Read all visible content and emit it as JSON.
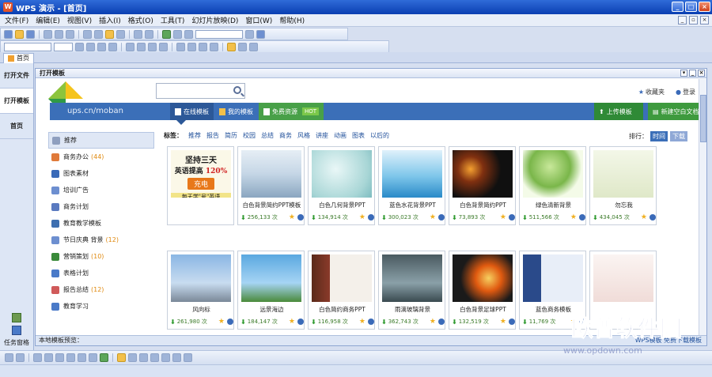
{
  "window": {
    "title": "WPS 演示 - [首页]",
    "minimize": "_",
    "maximize": "□",
    "close": "×"
  },
  "menu": [
    "文件(F)",
    "编辑(E)",
    "视图(V)",
    "插入(I)",
    "格式(O)",
    "工具(T)",
    "幻灯片放映(D)",
    "窗口(W)",
    "帮助(H)"
  ],
  "doc_tab": "首页",
  "left_pane": {
    "tabs": [
      "打开文件",
      "打开模板",
      "首页"
    ],
    "bottom_label": "任务窗格"
  },
  "panel": {
    "title": "打开模板",
    "search_placeholder": "",
    "favorites": "收藏夹",
    "login": "登录",
    "url": "ups.cn/moban",
    "tabs": {
      "online": "在线模板",
      "my": "我的模板",
      "free": "免费资源",
      "hot": "HOT"
    },
    "upload": "上传模板",
    "create": "新建空白文档",
    "tags_label": "标签：",
    "tags": [
      "推荐",
      "报告",
      "简历",
      "校园",
      "总结",
      "商务",
      "风格",
      "讲座",
      "动画",
      "图表",
      "以后的"
    ],
    "sort_label": "排行：",
    "sort_on": "时间",
    "sort_off": "下载",
    "categories": [
      {
        "label": "推荐",
        "count": ""
      },
      {
        "label": "商务办公",
        "count": "(44)"
      },
      {
        "label": "图表素材",
        "count": ""
      },
      {
        "label": "培训广告",
        "count": ""
      },
      {
        "label": "商务计划",
        "count": ""
      },
      {
        "label": "教育教学模板",
        "count": ""
      },
      {
        "label": "节日庆典 背景",
        "count": "(12)"
      },
      {
        "label": "营销策划",
        "count": "(10)"
      },
      {
        "label": "表格计划",
        "count": ""
      },
      {
        "label": "报告总结",
        "count": "(12)"
      },
      {
        "label": "教育学习",
        "count": ""
      }
    ],
    "cards": [
      {
        "title": "",
        "downloads": "",
        "ad_line1": "坚持三天",
        "ad_line2": "英语提高",
        "ad_pct": "120%",
        "ad_btn": "充电",
        "ad_footer": "每天学\"号\"英语"
      },
      {
        "title": "白色背景简约PPT模板",
        "downloads": "256,133 次"
      },
      {
        "title": "白色几何背景PPT",
        "downloads": "134,914 次"
      },
      {
        "title": "蓝色水花背景PPT",
        "downloads": "300,023 次"
      },
      {
        "title": "白色背景简约PPT",
        "downloads": "73,893 次"
      },
      {
        "title": "绿色清新背景",
        "downloads": "511,566 次"
      },
      {
        "title": "勿忘我",
        "downloads": "434,045 次"
      },
      {
        "title": "风向标",
        "downloads": "261,980 次"
      },
      {
        "title": "远景海边",
        "downloads": "184,147 次"
      },
      {
        "title": "白色简约商务PPT",
        "downloads": "116,958 次"
      },
      {
        "title": "雨滴玻璃背景",
        "downloads": "362,743 次"
      },
      {
        "title": "白色背景足球PPT",
        "downloads": "132,519 次"
      },
      {
        "title": "蓝色商务模板",
        "downloads": "11,769 次"
      },
      {
        "title": "",
        "downloads": ""
      }
    ],
    "status_left": "本地模板预览：",
    "status_link": "WPS模板 免费下载模板"
  },
  "watermark": {
    "text": "欧普软件园",
    "url": "www.opdown.com"
  },
  "colors": {
    "accent": "#3b6fb8",
    "green": "#48a048",
    "orange": "#e08a10"
  }
}
